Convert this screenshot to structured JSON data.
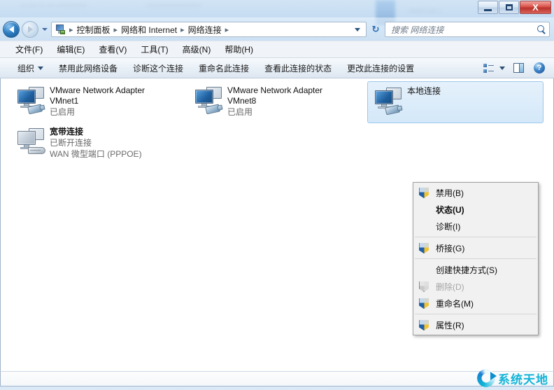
{
  "window": {
    "minimize_label": "最小化",
    "maximize_label": "最大化",
    "close_label": "X"
  },
  "address": {
    "back_label": "后退",
    "forward_label": "前进",
    "breadcrumb": [
      "控制面板",
      "网络和 Internet",
      "网络连接"
    ],
    "separator": "▸",
    "refresh_label": "↻"
  },
  "search": {
    "placeholder": "搜索 网络连接",
    "value": ""
  },
  "menubar": {
    "items": [
      {
        "label": "文件(F)"
      },
      {
        "label": "编辑(E)"
      },
      {
        "label": "查看(V)"
      },
      {
        "label": "工具(T)"
      },
      {
        "label": "高级(N)"
      },
      {
        "label": "帮助(H)"
      }
    ]
  },
  "commandbar": {
    "organize_label": "组织",
    "items": [
      {
        "label": "禁用此网络设备"
      },
      {
        "label": "诊断这个连接"
      },
      {
        "label": "重命名此连接"
      },
      {
        "label": "查看此连接的状态"
      },
      {
        "label": "更改此连接的设置"
      }
    ],
    "views_label": "更改您的视图",
    "preview_label": "显示预览窗格",
    "help_label": "?"
  },
  "connections": [
    {
      "name": "VMware Network Adapter",
      "name2": "VMnet1",
      "status": "已启用",
      "device": "",
      "icon": "network-adapter-icon",
      "state": "enabled",
      "selected": false
    },
    {
      "name": "VMware Network Adapter",
      "name2": "VMnet8",
      "status": "已启用",
      "device": "",
      "icon": "network-adapter-icon",
      "state": "enabled",
      "selected": false
    },
    {
      "name": "宽带连接",
      "name2": "",
      "status": "已断开连接",
      "device": "WAN 微型端口 (PPPOE)",
      "icon": "broadband-modem-icon",
      "state": "disconnected",
      "selected": false
    },
    {
      "name": "本地连接",
      "name2": "",
      "status": "",
      "device": "",
      "icon": "network-adapter-icon",
      "state": "enabled",
      "selected": true
    }
  ],
  "context_menu": {
    "items": [
      {
        "label": "禁用(B)",
        "shield": true,
        "bold": false,
        "disabled": false,
        "sep_after": false
      },
      {
        "label": "状态(U)",
        "shield": false,
        "bold": true,
        "disabled": false,
        "sep_after": false
      },
      {
        "label": "诊断(I)",
        "shield": false,
        "bold": false,
        "disabled": false,
        "sep_after": true
      },
      {
        "label": "桥接(G)",
        "shield": true,
        "bold": false,
        "disabled": false,
        "sep_after": true
      },
      {
        "label": "创建快捷方式(S)",
        "shield": false,
        "bold": false,
        "disabled": false,
        "sep_after": false
      },
      {
        "label": "删除(D)",
        "shield": true,
        "bold": false,
        "disabled": true,
        "sep_after": false
      },
      {
        "label": "重命名(M)",
        "shield": true,
        "bold": false,
        "disabled": false,
        "sep_after": true
      },
      {
        "label": "属性(R)",
        "shield": true,
        "bold": false,
        "disabled": false,
        "sep_after": false
      }
    ]
  },
  "statusbar": {
    "text": ""
  },
  "watermark": {
    "text": "系统天地"
  },
  "colors": {
    "selection_bg": "#d9eaf9",
    "selection_border": "#9dc8ea",
    "close_button": "#c2332b",
    "watermark": "#12b3d8",
    "window_chrome": "#cde1f4"
  }
}
